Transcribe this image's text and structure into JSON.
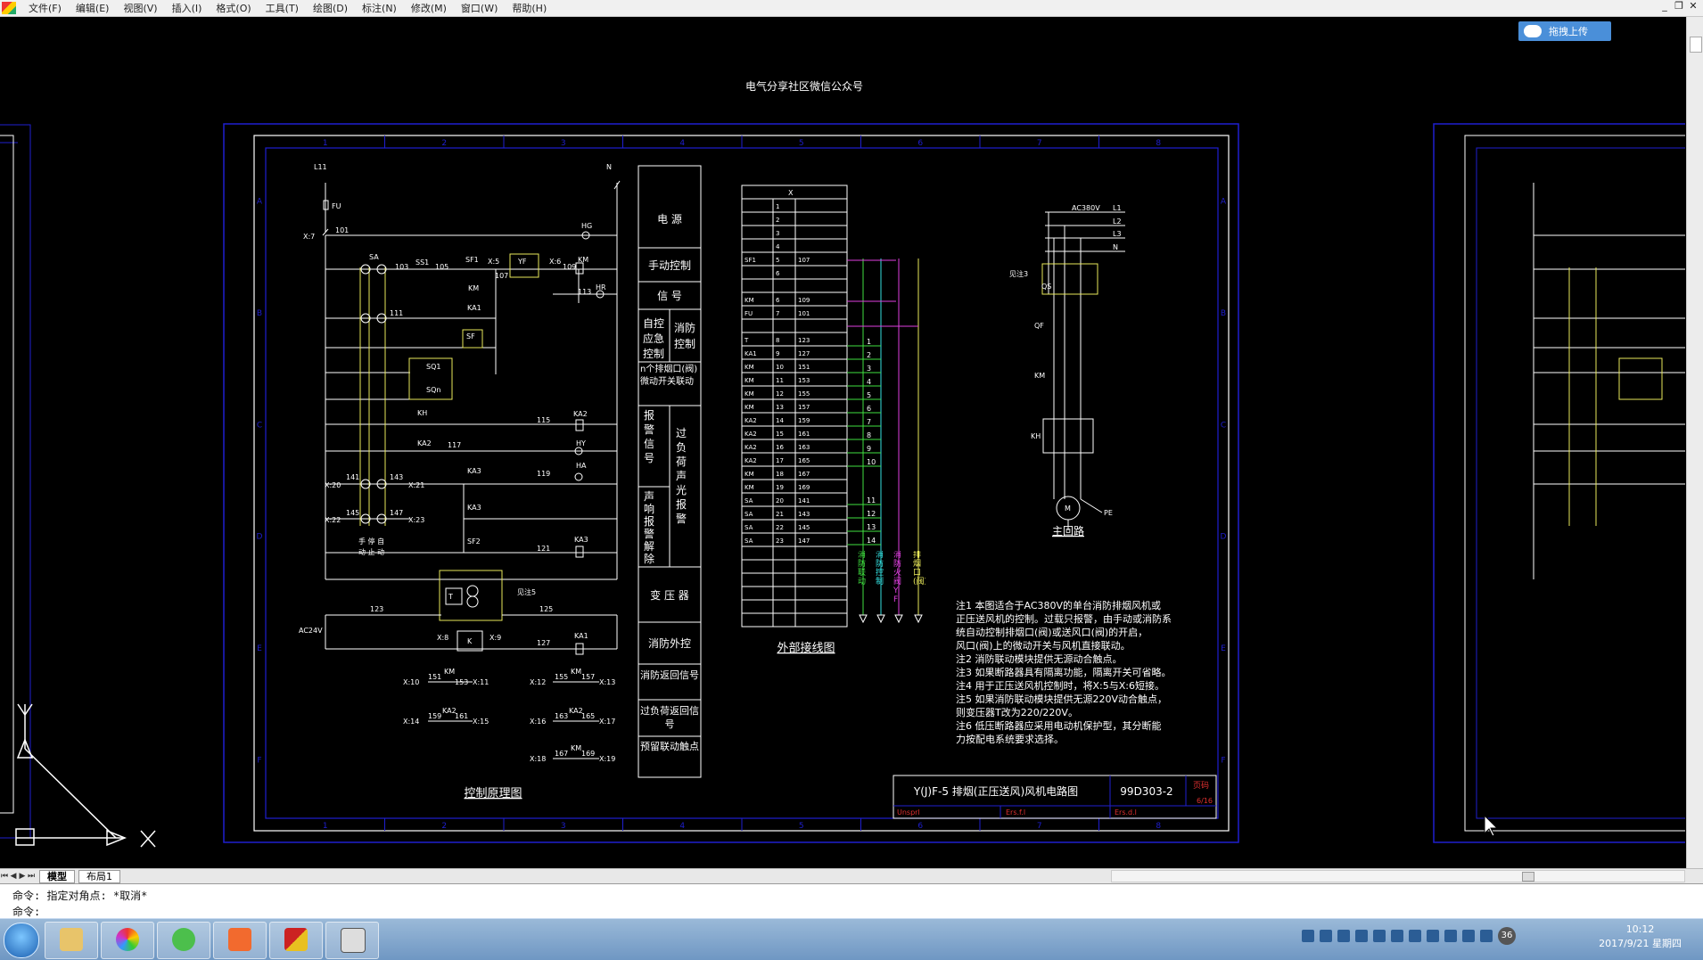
{
  "menubar": {
    "items": [
      "文件(F)",
      "编辑(E)",
      "视图(V)",
      "插入(I)",
      "格式(O)",
      "工具(T)",
      "绘图(D)",
      "标注(N)",
      "修改(M)",
      "窗口(W)",
      "帮助(H)"
    ]
  },
  "upload_button": {
    "label": "拖拽上传"
  },
  "drawing": {
    "header_note": "电气分享社区微信公众号",
    "frame_columns": [
      "1",
      "2",
      "3",
      "4",
      "5",
      "6",
      "7",
      "8"
    ],
    "frame_rows": [
      "A",
      "B",
      "C",
      "D",
      "E",
      "F"
    ],
    "control_title": "控制原理图",
    "external_title": "外部接线图",
    "main_circuit_title": "主回路",
    "legend_blocks": [
      "电 源",
      "手动控制",
      "信 号",
      "自控",
      "消防",
      "应急",
      "控制",
      "n个排烟口(阀)微动开关联动",
      "报警信号",
      "过负荷声光报警",
      "声响报警解除",
      "变 压 器",
      "消防外控",
      "消防返回信号",
      "过负荷返回信号",
      "预留联动触点"
    ],
    "notes": [
      "注1  本图适合于AC380V的单台消防排烟风机或",
      "正压送风机的控制。过载只报警，由手动或消防系",
      "统自动控制排烟口(阀)或送风口(阀)的开启，",
      "风口(阀)上的微动开关与风机直接联动。",
      "注2  消防联动模块提供无源动合触点。",
      "注3  如果断路器具有隔离功能，隔离开关可省略。",
      "注4  用于正压送风机控制时，将X:5与X:6短接。",
      "注5  如果消防联动模块提供无源220V动合触点，",
      "则变压器T改为220/220V。",
      "注6  低压断路器应采用电动机保护型，其分断能",
      "力按配电系统要求选择。"
    ],
    "title_block": {
      "name": "Y(J)F-5 排烟(正压送风)风机电路图",
      "code": "99D303-2",
      "stamp": "页码",
      "sheet": "6/16",
      "cells": [
        "Unsprl",
        "Ers.f.l",
        "Ers.d.l"
      ]
    },
    "main_circuit_labels": {
      "voltage": "AC380V",
      "phases": [
        "L1",
        "L2",
        "L3",
        "N"
      ],
      "qs": "QS",
      "qf": "QF",
      "km": "KM",
      "kh": "KH",
      "note": "见注3",
      "pe": "PE",
      "m": "M"
    },
    "ext_table": {
      "header": "X",
      "rows": [
        [
          "",
          "1",
          ""
        ],
        [
          "",
          "2",
          ""
        ],
        [
          "",
          "3",
          ""
        ],
        [
          "",
          "4",
          ""
        ],
        [
          "SF1",
          "5",
          "107"
        ],
        [
          "",
          "6",
          ""
        ],
        [
          "",
          "",
          ""
        ],
        [
          "KM",
          "6",
          "109"
        ],
        [
          "FU",
          "7",
          "101"
        ],
        [
          "",
          "",
          ""
        ],
        [
          "T",
          "8",
          "123"
        ],
        [
          "KA1",
          "9",
          "127"
        ],
        [
          "KM",
          "10",
          "151"
        ],
        [
          "KM",
          "11",
          "153"
        ],
        [
          "KM",
          "12",
          "155"
        ],
        [
          "KM",
          "13",
          "157"
        ],
        [
          "KA2",
          "14",
          "159"
        ],
        [
          "KA2",
          "15",
          "161"
        ],
        [
          "KA2",
          "16",
          "163"
        ],
        [
          "KA2",
          "17",
          "165"
        ],
        [
          "KM",
          "18",
          "167"
        ],
        [
          "KM",
          "19",
          "169"
        ],
        [
          "SA",
          "20",
          "141"
        ],
        [
          "SA",
          "21",
          "143"
        ],
        [
          "SA",
          "22",
          "145"
        ],
        [
          "SA",
          "23",
          "147"
        ],
        [
          "",
          "",
          ""
        ],
        [
          "",
          "",
          ""
        ],
        [
          "",
          "",
          ""
        ],
        [
          "",
          "",
          ""
        ],
        [
          "",
          "",
          ""
        ],
        [
          "",
          "",
          ""
        ]
      ],
      "terminal_numbers": [
        "1",
        "2",
        "3",
        "4",
        "5",
        "6",
        "7",
        "8",
        "9",
        "10",
        "11",
        "12",
        "13",
        "14"
      ],
      "bus_labels": [
        "消防联动",
        "消防控制",
        "消防火阀YF",
        "排烟口(阀)"
      ]
    },
    "control_labels": {
      "l11": "L11",
      "n": "N",
      "fu": "FU",
      "x7": "X:7",
      "n101": "101",
      "hg": "HG",
      "sa": "SA",
      "ss1": "SS1",
      "n103": "103",
      "n105": "105",
      "sf1": "SF1",
      "x5": "X:5",
      "yf": "YF",
      "x6": "X:6",
      "km": "KM",
      "n109": "109",
      "n107": "107",
      "n113": "113",
      "hr": "HR",
      "n111": "111",
      "ka1": "KA1",
      "sf": "SF",
      "sq1": "SQ1",
      "sqn": "SQn",
      "kh": "KH",
      "n115": "115",
      "ka2": "KA2",
      "n117": "117",
      "hy": "HY",
      "x20": "X:20",
      "x21": "X:21",
      "x22": "X:22",
      "x23": "X:23",
      "n141": "141",
      "n143": "143",
      "n145": "145",
      "n147": "147",
      "ka3": "KA3",
      "n119": "119",
      "ha": "HA",
      "sf2": "SF2",
      "n121": "121",
      "modes": "手 停 自",
      "modes2": "动 止 动",
      "t": "T",
      "note5": "见注5",
      "n123": "123",
      "n125": "125",
      "ac24v": "AC24V",
      "x8": "X:8",
      "k": "K",
      "x9": "X:9",
      "n127": "127",
      "x10": "X:10",
      "n151": "151",
      "n153": "153",
      "x11": "X:11",
      "x12": "X:12",
      "n155": "155",
      "n157": "157",
      "x13": "X:13",
      "x14": "X:14",
      "n159": "159",
      "n161": "161",
      "x15": "X:15",
      "x16": "X:16",
      "n163": "163",
      "n165": "165",
      "x17": "X:17",
      "x18": "X:18",
      "n167": "167",
      "n169": "169",
      "x19": "X:19"
    }
  },
  "layout_tabs": [
    "模型",
    "布局1"
  ],
  "command": {
    "line1": "命令: 指定对角点: *取消*",
    "line2": "命令:"
  },
  "taskbar": {
    "time": "10:12",
    "date": "2017/9/21 星期四",
    "badge": "36"
  },
  "colors": {
    "frame": "#1f1fd0",
    "line": "#ffffff",
    "yellow": "#e8e85a",
    "cyan": "#33e0e0",
    "magenta": "#e040e0",
    "green": "#40e040",
    "red": "#e03030"
  }
}
